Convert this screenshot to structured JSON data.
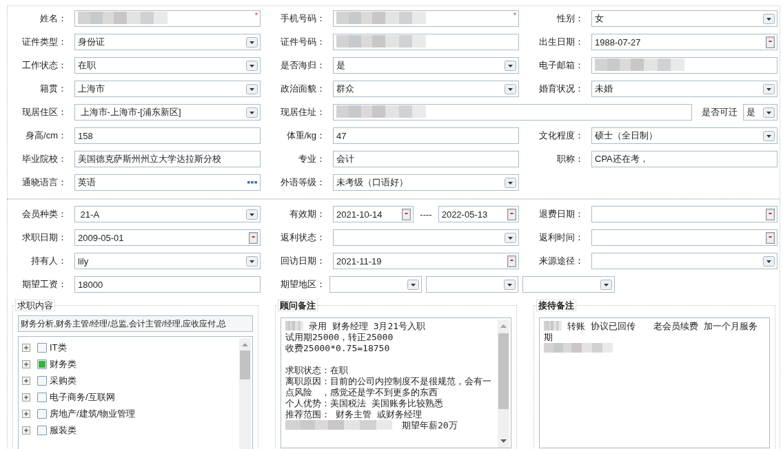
{
  "profile": {
    "fields": [
      {
        "label": "姓名：",
        "kind": "masked",
        "mark": "*"
      },
      {
        "label": "手机号码：",
        "kind": "masked",
        "mark": "*"
      },
      {
        "label": "性别：",
        "kind": "select",
        "value": "女"
      },
      {
        "label": "证件类型：",
        "kind": "select",
        "value": "身份证"
      },
      {
        "label": "证件号码：",
        "kind": "masked"
      },
      {
        "label": "出生日期：",
        "kind": "date",
        "value": "1988-07-27"
      },
      {
        "label": "工作状态：",
        "kind": "select",
        "value": "在职"
      },
      {
        "label": "是否海归：",
        "kind": "select",
        "value": "是"
      },
      {
        "label": "电子邮箱：",
        "kind": "masked"
      },
      {
        "label": "籍贯：",
        "kind": "select",
        "value": "上海市"
      },
      {
        "label": "政治面貌：",
        "kind": "select",
        "value": "群众"
      },
      {
        "label": "婚育状况：",
        "kind": "select",
        "value": "未婚"
      },
      {
        "label": "现居住区：",
        "kind": "select",
        "value": " 上海市-上海市-[浦东新区]"
      },
      {
        "label": "现居住址：",
        "kind": "address",
        "parts": [
          {
            "kind": "masked"
          },
          {
            "kind": "label",
            "text": "是否可迁"
          },
          {
            "kind": "select",
            "value": "是"
          }
        ]
      },
      {
        "label": "身高/cm：",
        "kind": "text",
        "value": "158"
      },
      {
        "label": "体重/kg：",
        "kind": "text",
        "value": "47"
      },
      {
        "label": "文化程度：",
        "kind": "select",
        "value": "硕士（全日制）"
      },
      {
        "label": "毕业院校：",
        "kind": "text",
        "value": "美国德克萨斯州州立大学达拉斯分校"
      },
      {
        "label": "专业：",
        "kind": "text",
        "value": "会计"
      },
      {
        "label": "职称：",
        "kind": "text",
        "value": "CPA还在考，"
      },
      {
        "label": "通晓语言：",
        "kind": "lookup",
        "value": "英语"
      },
      {
        "label": "外语等级：",
        "kind": "select",
        "value": "未考级（口语好）"
      }
    ]
  },
  "membership": {
    "fields": [
      {
        "label": "会员种类：",
        "kind": "select",
        "value": " 21-A"
      },
      {
        "label": "有效期：",
        "kind": "range",
        "parts": [
          {
            "kind": "date",
            "value": "2021-10-14"
          },
          {
            "kind": "label",
            "text": "----"
          },
          {
            "kind": "date",
            "value": "2022-05-13"
          }
        ]
      },
      {
        "label": "退费日期：",
        "kind": "date"
      },
      {
        "label": "求职日期：",
        "kind": "date",
        "value": "2009-05-01"
      },
      {
        "label": "返利状态：",
        "kind": "select"
      },
      {
        "label": "返利时间：",
        "kind": "date"
      },
      {
        "label": "持有人：",
        "kind": "select",
        "value": "lily"
      },
      {
        "label": "回访日期：",
        "kind": "date",
        "value": "2021-11-19"
      },
      {
        "label": "来源途径：",
        "kind": "select"
      },
      {
        "label": "期望工资：",
        "kind": "text",
        "value": "18000"
      },
      {
        "label": "期望地区：",
        "kind": "multi",
        "parts": [
          {
            "kind": "select"
          },
          {
            "kind": "select"
          },
          {
            "kind": "select"
          }
        ]
      }
    ]
  },
  "job_content": {
    "legend": "求职内容",
    "legend_bold": false,
    "selection": "财务分析,财务主管/经理/总监,会计主管/经理,应收应付,总",
    "items": [
      {
        "label": "IT类",
        "checked": false,
        "expanded": false
      },
      {
        "label": "财务类",
        "checked": true,
        "expanded": false
      },
      {
        "label": "采购类",
        "checked": false,
        "expanded": false
      },
      {
        "label": "电子商务/互联网",
        "checked": false,
        "expanded": false
      },
      {
        "label": "房地产/建筑/物业管理",
        "checked": false,
        "expanded": false
      },
      {
        "label": "服装类",
        "checked": false,
        "expanded": false
      }
    ]
  },
  "notes": [
    {
      "legend": "顾问备注",
      "legend_bold": true,
      "scroll": true,
      "lines": [
        {
          "kind": "masked_text",
          "text": "录用 财务经理 3月21号入职"
        },
        {
          "kind": "text",
          "text": "试用期25000，转正25000"
        },
        {
          "kind": "text",
          "text": "收费25000*0.75=18750"
        },
        {
          "kind": "blank"
        },
        {
          "kind": "text",
          "text": "求职状态：在职"
        },
        {
          "kind": "text",
          "text": "离职原因：目前的公司内控制度不是很规范，会有一点风险　，感觉还是学不到更多的东西"
        },
        {
          "kind": "text",
          "text": "个人优势：美国税法 美国账务比较熟悉"
        },
        {
          "kind": "text",
          "text": "推荐范围： 财务主管 或财务经理"
        },
        {
          "kind": "long_masked_text",
          "text": "期望年薪20万"
        }
      ]
    },
    {
      "legend": "接待备注",
      "legend_bold": true,
      "scroll": false,
      "lines": [
        {
          "kind": "masked_text",
          "text": "转账 协议已回传　　老会员续费 加一个月服务期"
        },
        {
          "kind": "redacted"
        }
      ]
    }
  ]
}
